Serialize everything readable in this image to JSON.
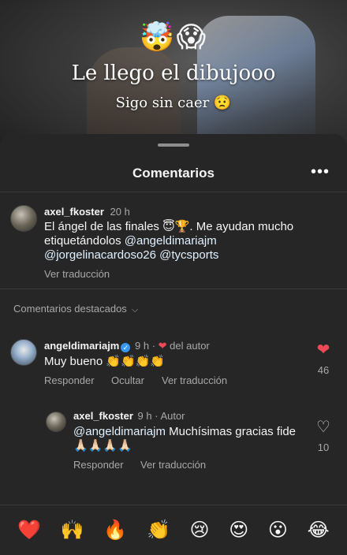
{
  "story": {
    "emojis": "🤯😱",
    "headline": "Le llego el dibujooo",
    "subline": "Sigo sin caer 😟"
  },
  "sheet": {
    "title": "Comentarios",
    "more": "•••"
  },
  "comments": [
    {
      "user": "axel_fkoster",
      "time": "20 h",
      "text_line1": "El ángel de las finales 😇🏆. Me ayudan mucho",
      "text_line2_prefix": "etiquetándolos ",
      "mention1": "@angeldimariajm",
      "mention2": "@jorgelinacardoso26",
      "mention3": "@tycsports",
      "see_translation": "Ver traducción"
    }
  ],
  "featured_label": "Comentarios destacados",
  "featured": [
    {
      "user": "angeldimariajm",
      "verified": true,
      "time": "9 h",
      "by_author": "del autor",
      "text": "Muy bueno 👏👏👏👏",
      "reply": "Responder",
      "hide": "Ocultar",
      "see_translation": "Ver traducción",
      "likes": "46"
    },
    {
      "user": "axel_fkoster",
      "time": "9 h",
      "author": "Autor",
      "mention": "@angeldimariajm",
      "text_after_mention": " Muchísimas gracias fide",
      "text_line2": "🙏🏻🙏🏻🙏🏻🙏🏻",
      "reply": "Responder",
      "see_translation": "Ver traducción",
      "likes": "10"
    }
  ],
  "emoji_bar": [
    "❤️",
    "🙌",
    "🔥",
    "👏",
    "😢",
    "😍",
    "😮",
    "😂"
  ],
  "colors": {
    "background": "#262626",
    "like_red": "#ed4956",
    "verified_blue": "#3797f0",
    "muted": "#a8a8a8"
  }
}
